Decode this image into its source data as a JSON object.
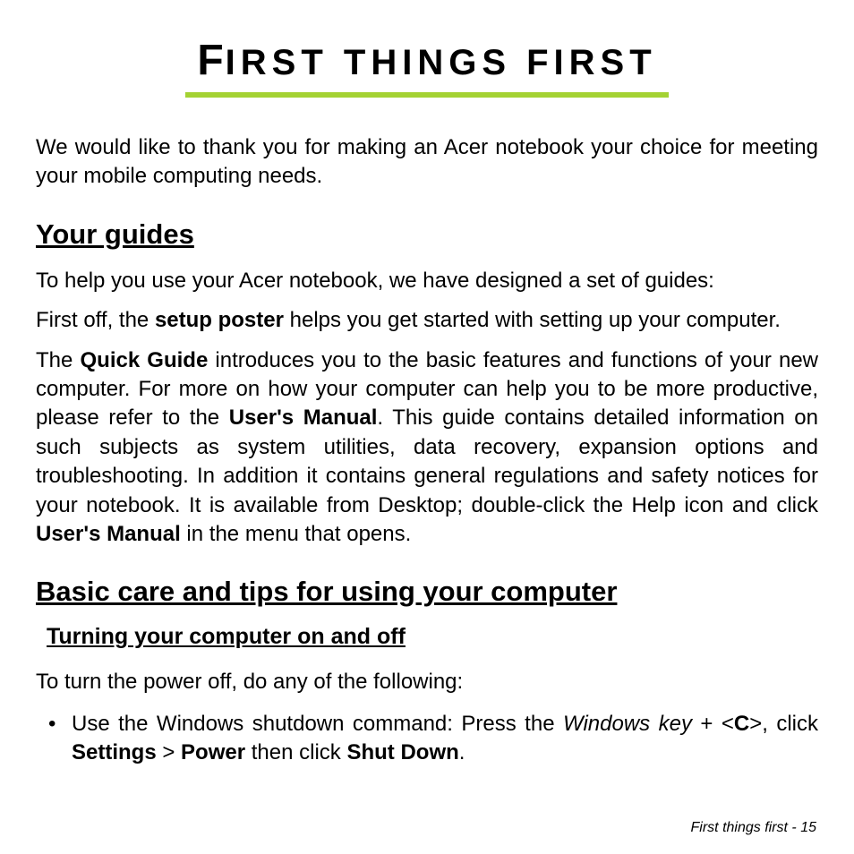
{
  "title": {
    "cap1": "F",
    "rest1": "IRST THINGS FIRST"
  },
  "intro": "We would like to thank you for making an Acer notebook your choice for meeting your mobile computing needs.",
  "section1": {
    "heading": "Your guides",
    "p1": "To help you use your Acer notebook, we have designed a set of guides:",
    "p2_a": "First off, the ",
    "p2_b": "setup poster",
    "p2_c": " helps you get started with setting up your computer.",
    "p3_a": "The ",
    "p3_b": "Quick Guide",
    "p3_c": " introduces you to the basic features and functions of your new computer. For more on how your computer can help you to be more productive, please refer to the ",
    "p3_d": "User's Manual",
    "p3_e": ". This guide contains detailed information on such subjects as system utilities, data recovery, expansion options and troubleshooting. In addition it contains general regulations and safety notices for your notebook. It is available from Desktop; double-click the Help icon and click ",
    "p3_f": "User's Manual",
    "p3_g": " in the menu that opens."
  },
  "section2": {
    "heading": "Basic care and tips for using your computer",
    "sub1": "Turning your computer on and off",
    "p1": "To turn the power off, do any of the following:",
    "bullet1_a": "Use the Windows shutdown command: Press the ",
    "bullet1_b": "Windows key",
    "bullet1_c": " + <",
    "bullet1_d": "C",
    "bullet1_e": ">, click ",
    "bullet1_f": "Settings",
    "bullet1_g": " > ",
    "bullet1_h": "Power",
    "bullet1_i": " then click ",
    "bullet1_j": "Shut Down",
    "bullet1_k": "."
  },
  "footer": "First things first -  15"
}
